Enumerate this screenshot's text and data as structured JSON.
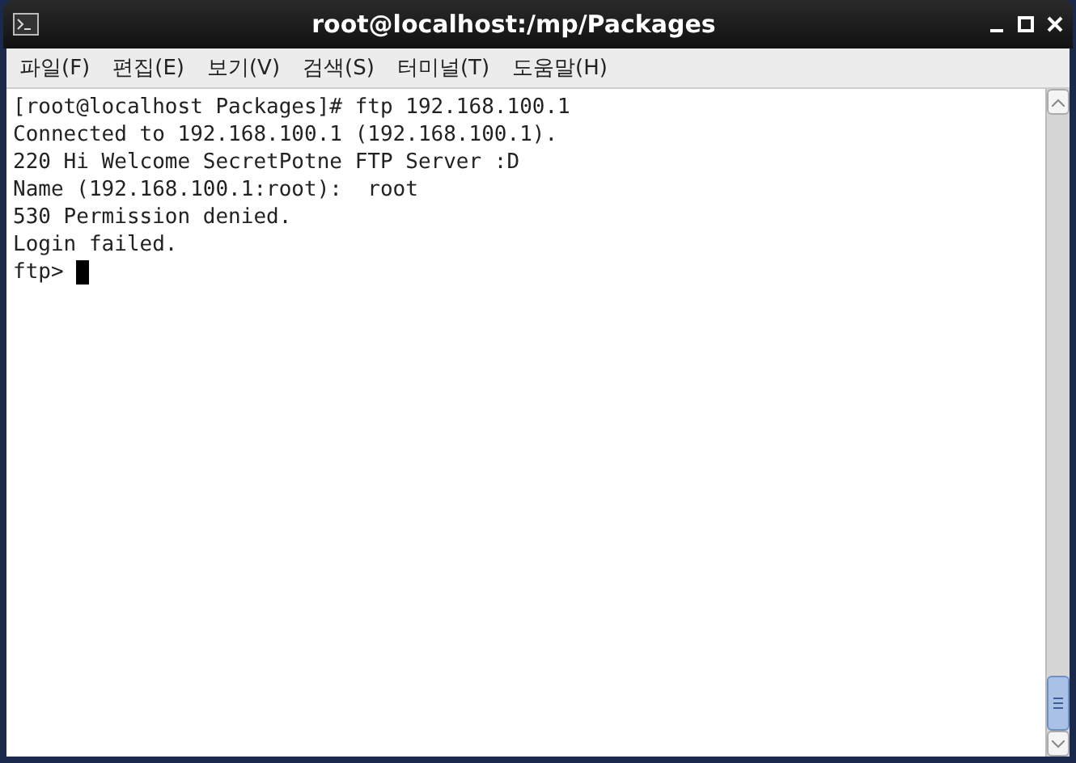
{
  "window": {
    "title": "root@localhost:/mp/Packages"
  },
  "menu": [
    "파일(F)",
    "편집(E)",
    "보기(V)",
    "검색(S)",
    "터미널(T)",
    "도움말(H)"
  ],
  "terminal": {
    "lines": [
      "[root@localhost Packages]# ftp 192.168.100.1",
      "Connected to 192.168.100.1 (192.168.100.1).",
      "220 Hi Welcome SecretPotne FTP Server :D",
      "Name (192.168.100.1:root):  root",
      "530 Permission denied.",
      "Login failed."
    ],
    "prompt": "ftp>"
  }
}
